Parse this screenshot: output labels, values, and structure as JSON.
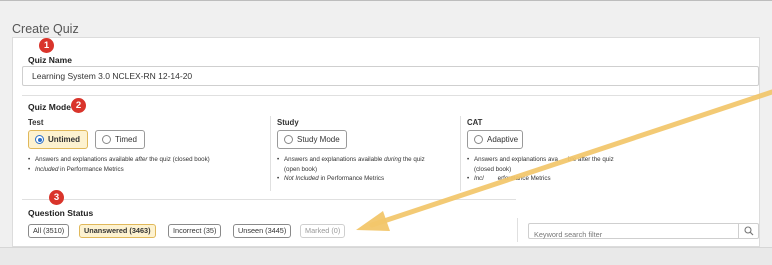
{
  "page": {
    "title": "Create Quiz",
    "accent_color": "#d9342b",
    "arrow_color": "#f2c66a"
  },
  "quiz_name": {
    "badge": "1",
    "label": "Quiz Name",
    "value": "Learning System 3.0 NCLEX-RN 12-14-20"
  },
  "quiz_mode": {
    "badge": "2",
    "label": "Quiz Mode",
    "test": {
      "title": "Test",
      "options": [
        {
          "label": "Untimed",
          "selected": true
        },
        {
          "label": "Timed",
          "selected": false
        }
      ],
      "note1_a": "Answers and explanations available ",
      "note1_b": "after",
      "note1_c": " the quiz (closed book)",
      "note2_a": "Included",
      "note2_b": " in Performance Metrics"
    },
    "study": {
      "title": "Study",
      "option": "Study Mode",
      "note1_a": "Answers and explanations available ",
      "note1_b": "during",
      "note1_c": " the quiz",
      "note1_d": "(open book)",
      "note2_a": "Not Included",
      "note2_b": " in Performance Metrics"
    },
    "cat": {
      "title": "CAT",
      "option": "Adaptive",
      "note1_a": "Answers and explanations ava",
      "note1_c": "ble after the quiz",
      "note1_d": "(closed book)",
      "note2_a": "Incl",
      "note2_b": "erformance Metrics"
    }
  },
  "question_status": {
    "badge": "3",
    "label": "Question Status",
    "filters": [
      "All (3510)",
      "Unanswered (3463)",
      "Incorrect (35)",
      "Unseen (3445)",
      "Marked (0)"
    ],
    "active_index": 1,
    "search_placeholder": "Keyword search filter",
    "search_icon": "magnifier-icon"
  }
}
